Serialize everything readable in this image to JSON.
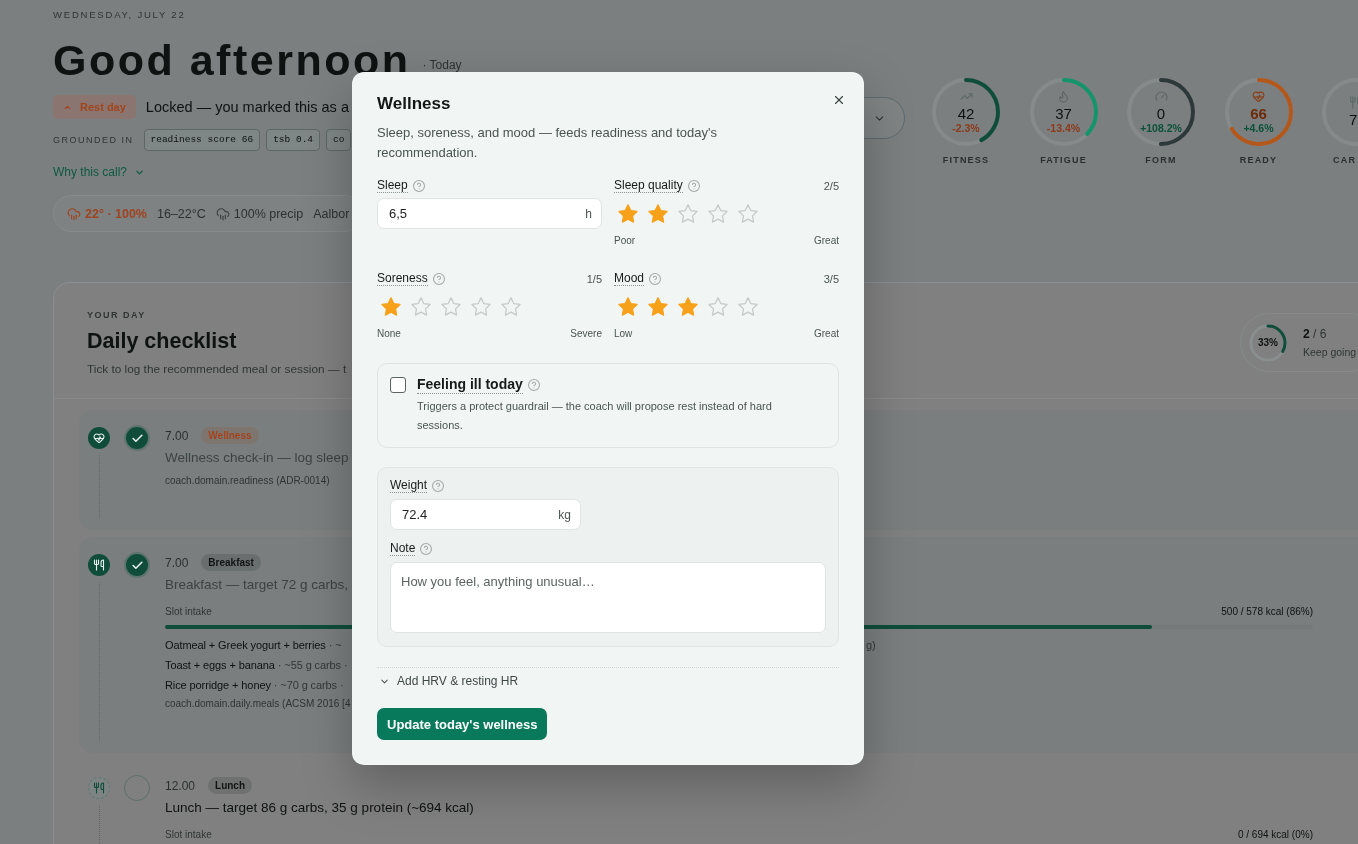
{
  "header": {
    "date": "WEDNESDAY, JULY 22",
    "greeting": "Good afternoon",
    "subtitle": "· Today",
    "day_badge": "Rest day",
    "status": "Locked — you marked this as a",
    "grounded": {
      "label": "GROUNDED IN",
      "chips": [
        "readiness score 66",
        "tsb 0.4",
        "co"
      ]
    },
    "why_link": "Why this call?",
    "weather": {
      "headline": "22° · 100%",
      "range": "16–22°C",
      "precip": "100% precip",
      "place": "Aalbor"
    }
  },
  "metrics": [
    {
      "kind": "fitness",
      "value": "42",
      "delta": "-2.3%",
      "falling": true,
      "label": "FITNESS",
      "level": 0.42,
      "color": "#0f4d3a",
      "emphasis": false,
      "clipped": false
    },
    {
      "kind": "fatigue",
      "value": "37",
      "delta": "-13.4%",
      "falling": true,
      "label": "FATIGUE",
      "level": 0.37,
      "color": "#14936c",
      "emphasis": false,
      "clipped": false
    },
    {
      "kind": "form",
      "value": "0",
      "delta": "+108.2%",
      "falling": false,
      "label": "FORM",
      "level": 0.5,
      "color": "#2d383b",
      "emphasis": false,
      "clipped": false
    },
    {
      "kind": "ready",
      "value": "66",
      "delta": "+4.6%",
      "falling": false,
      "label": "READY",
      "level": 0.66,
      "color": "#b3571b",
      "emphasis": true,
      "clipped": false
    },
    {
      "kind": "carbs",
      "value": "7",
      "label": "CAR",
      "emphasis": false,
      "clipped": true
    }
  ],
  "checklist": {
    "eyebrow": "YOUR DAY",
    "title": "Daily checklist",
    "subtitle": "Tick to log the recommended meal or session — t",
    "progress": {
      "percent": "33%",
      "level": 0.33,
      "count": "**2** / 6",
      "caption": "Keep going"
    },
    "items": [
      {
        "kind": "wellness",
        "checked": true,
        "time": "7.00",
        "tag": {
          "label": "Wellness",
          "color": "#a3441d"
        },
        "title": "Wellness check-in — log sleep",
        "source": "coach.domain.readiness (ADR-0014)"
      },
      {
        "kind": "meal",
        "checked": true,
        "time": "7.00",
        "tag": {
          "label": "Breakfast",
          "color": "#101514"
        },
        "title": "Breakfast — target 72 g carbs,",
        "intake": {
          "label": "Slot intake",
          "reading": "500 / 578 kcal (86%)",
          "level": 0.86
        },
        "options": [
          {
            "name": "Oatmeal + Greek yogurt + berries",
            "detail": "· ~",
            "tail": "g)"
          },
          {
            "name": "Toast + eggs + banana",
            "detail": "· ~55 g carbs ·"
          },
          {
            "name": "Rice porridge + honey",
            "detail": "· ~70 g carbs ·"
          }
        ],
        "source": "coach.domain.daily.meals (ACSM 2016 [4"
      },
      {
        "kind": "meal",
        "checked": false,
        "time": "12.00",
        "tag": {
          "label": "Lunch",
          "color": "#101514"
        },
        "title": "Lunch — target 86 g carbs, 35 g protein (~694 kcal)",
        "intake": {
          "label": "Slot intake",
          "reading": "0 / 694 kcal (0%)"
        }
      }
    ]
  },
  "dialog": {
    "title": "Wellness",
    "description": "Sleep, soreness, and mood — feeds readiness and today's recommendation.",
    "fields": [
      {
        "kind": "number",
        "label": "Sleep",
        "value": "6,5",
        "unit": "h"
      },
      {
        "kind": "rating",
        "label": "Sleep quality",
        "reading": "2/5",
        "stars": 2,
        "low": "Poor",
        "high": "Great"
      },
      {
        "kind": "rating",
        "label": "Soreness",
        "reading": "1/5",
        "stars": 1,
        "low": "None",
        "high": "Severe"
      },
      {
        "kind": "rating",
        "label": "Mood",
        "reading": "3/5",
        "stars": 3,
        "low": "Low",
        "high": "Great"
      }
    ],
    "ill": {
      "label": "Feeling ill today",
      "description": "Triggers a protect guardrail — the coach will propose rest instead of hard sessions.",
      "checked": false
    },
    "weight": {
      "label": "Weight",
      "value": "72.4",
      "unit": "kg"
    },
    "note": {
      "label": "Note",
      "placeholder": "How you feel, anything unusual…"
    },
    "hrv": {
      "label": "Add HRV & resting HR",
      "expanded": false
    },
    "submit": "Update today's wellness"
  }
}
